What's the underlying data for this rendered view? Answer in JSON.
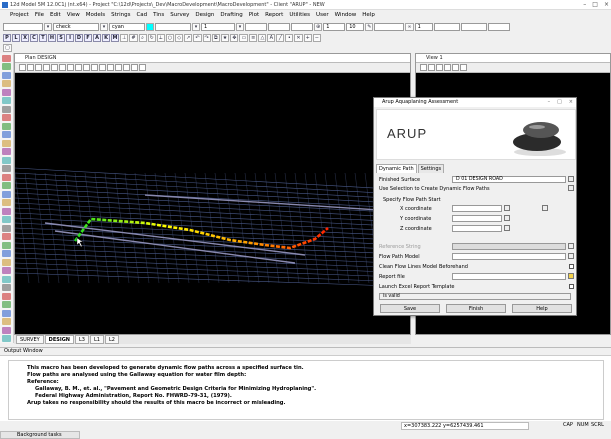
{
  "window": {
    "title": "12d Model 5M 12.0C1j (nt.x64) - Project \"C:\\12d\\Projects\\_Dev\\MacroDevelopment\\MacroDevelopment\" - Client \"ARUP\" - NEW",
    "controls": [
      "–",
      "□",
      "×"
    ]
  },
  "menu": [
    "Project",
    "File",
    "Edit",
    "View",
    "Models",
    "Strings",
    "Cad",
    "Tins",
    "Survey",
    "Design",
    "Drafting",
    "Plot",
    "Report",
    "Utilities",
    "User",
    "Window",
    "Help"
  ],
  "toolbar": {
    "model_value": "check",
    "colour_value": "cyan",
    "field_1": "1",
    "field_10": "10",
    "field_a": "1",
    "field_b": "1",
    "letters": [
      "P",
      "L",
      "X",
      "C",
      "T",
      "H",
      "S",
      "I",
      "D",
      "F",
      "A",
      "K",
      "M"
    ]
  },
  "plan_view": {
    "title": "Plan DESIGN"
  },
  "view1": {
    "title": "View 1"
  },
  "view_tabs": [
    "SURVEY",
    "DESIGN",
    "L3",
    "L1",
    "L2"
  ],
  "active_view_tab": "DESIGN",
  "output": {
    "title": "Output Window",
    "lines": [
      "This macro has been developed to generate dynamic flow paths across a specified surface tin.",
      "Flow paths are analysed using the Gallaway equation for water film depth:",
      "Reference:",
      "Gallaway, B. M., et. al., \"Pavement and Geometric Design Criteria for Minimizing Hydroplaning\".",
      "Federal Highway Administration, Report No. FHWRD-79-31, (1979).",
      "Arup takes no responsibility should the results of this macro be incorrect or misleading."
    ]
  },
  "status": {
    "coords": "x=307383.222 y=6257439.461",
    "caps": "CAP",
    "num": "NUM",
    "scroll": "SCRL"
  },
  "background_tasks": "Background tasks",
  "dialog": {
    "title": "Arup Aquaplaning Assessment",
    "logo": "ARUP",
    "tabs": [
      "Dynamic Path",
      "Settings"
    ],
    "finished_surface_label": "Finished Surface",
    "finished_surface_value": "D 01 DESIGN ROAD",
    "use_selection_label": "Use Selection to Create Dynamic Flow Paths",
    "specify_start_label": "Specify Flow Path Start",
    "x_label": "X coordinate",
    "y_label": "Y coordinate",
    "z_label": "Z coordinate",
    "reference_string_label": "Reference String",
    "flow_model_label": "Flow Path Model",
    "clean_flow_label": "Clean Flow Lines Model Beforehand",
    "report_file_label": "Report file",
    "launch_excel_label": "Launch Excel Report Template",
    "message": "is valid",
    "buttons": {
      "save": "Save",
      "finish": "Finish",
      "help": "Help"
    }
  }
}
